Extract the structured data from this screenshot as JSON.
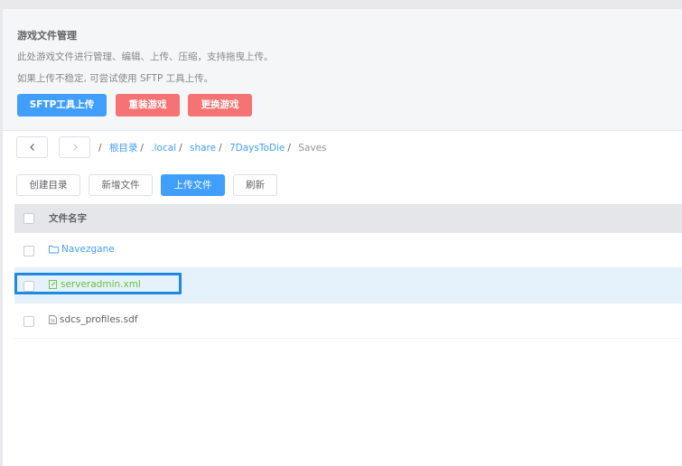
{
  "header": {
    "title": "游戏文件管理",
    "desc1": "此处游戏文件进行管理、编辑、上传、压缩，支持拖曳上传。",
    "desc2": "如果上传不稳定, 可尝试使用 SFTP 工具上传。",
    "buttons": {
      "sftp": "SFTP工具上传",
      "reinstall": "重装游戏",
      "change": "更换游戏"
    }
  },
  "nav": {
    "back_icon": "chevron-left-icon",
    "forward_icon": "chevron-right-icon"
  },
  "breadcrumb": {
    "lead_sep": "/",
    "items": [
      {
        "label": "根目录",
        "sep": "/"
      },
      {
        "label": ".local",
        "sep": "/"
      },
      {
        "label": "share",
        "sep": "/"
      },
      {
        "label": "7DaysToDie",
        "sep": "/"
      }
    ],
    "current": "Saves"
  },
  "toolbar": {
    "mkdir": "创建目录",
    "newfile": "新增文件",
    "upload": "上传文件",
    "refresh": "刷新"
  },
  "table": {
    "header": "文件名字",
    "rows": [
      {
        "name": "Navezgane",
        "icon": "folder-icon",
        "color": "#409eff"
      },
      {
        "name": "serveradmin.xml",
        "icon": "edit-file-icon",
        "color": "#67c23a"
      },
      {
        "name": "sdcs_profiles.sdf",
        "icon": "file-icon",
        "color": "#606266"
      }
    ]
  },
  "colors": {
    "primary": "#409eff",
    "danger": "#f56c6c",
    "success": "#67c23a",
    "highlight": "#1e88e5"
  }
}
